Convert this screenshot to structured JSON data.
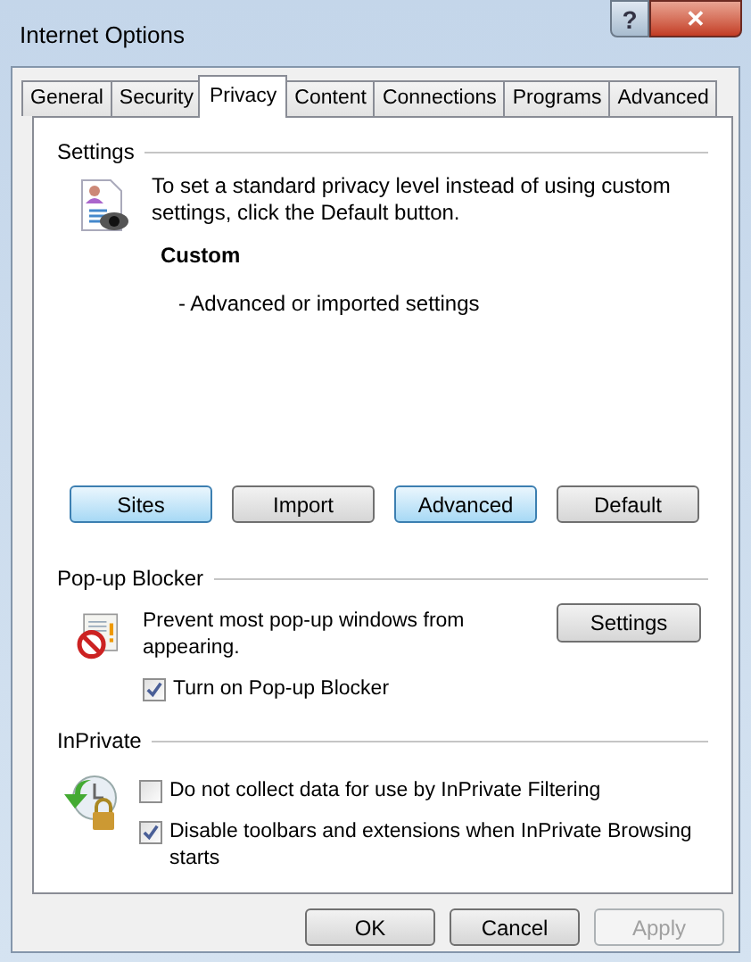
{
  "window": {
    "title": "Internet Options",
    "help_button": "?",
    "close_button": "✕"
  },
  "tabs": [
    {
      "label": "General",
      "selected": false
    },
    {
      "label": "Security",
      "selected": false
    },
    {
      "label": "Privacy",
      "selected": true
    },
    {
      "label": "Content",
      "selected": false
    },
    {
      "label": "Connections",
      "selected": false
    },
    {
      "label": "Programs",
      "selected": false
    },
    {
      "label": "Advanced",
      "selected": false
    }
  ],
  "settings": {
    "heading": "Settings",
    "description": "To set a standard privacy level instead of using custom settings, click the Default button.",
    "level_name": "Custom",
    "level_detail": "- Advanced or imported settings",
    "buttons": [
      {
        "label": "Sites",
        "highlighted": true
      },
      {
        "label": "Import",
        "highlighted": false
      },
      {
        "label": "Advanced",
        "highlighted": true
      },
      {
        "label": "Default",
        "highlighted": false
      }
    ]
  },
  "popup_blocker": {
    "heading": "Pop-up Blocker",
    "description": "Prevent most pop-up windows from appearing.",
    "settings_button": "Settings",
    "checkbox": {
      "label": "Turn on Pop-up Blocker",
      "checked": true
    }
  },
  "inprivate": {
    "heading": "InPrivate",
    "checkboxes": [
      {
        "label": "Do not collect data for use by InPrivate Filtering",
        "checked": false
      },
      {
        "label": "Disable toolbars and extensions when InPrivate Browsing starts",
        "checked": true
      }
    ]
  },
  "footer_buttons": [
    {
      "label": "OK",
      "disabled": false
    },
    {
      "label": "Cancel",
      "disabled": false
    },
    {
      "label": "Apply",
      "disabled": true
    }
  ]
}
